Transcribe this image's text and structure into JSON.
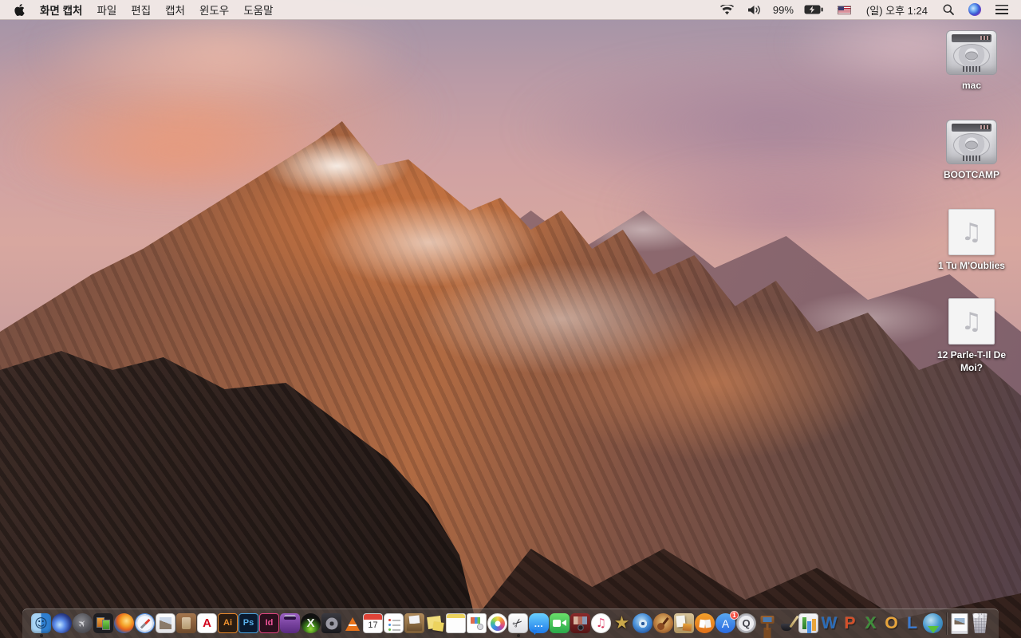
{
  "menu_bar": {
    "app_name": "화면 캡처",
    "menus": [
      "파일",
      "편집",
      "캡처",
      "윈도우",
      "도움말"
    ],
    "battery_percent": "99%",
    "clock": "(일) 오후 1:24",
    "status_icons": [
      "wifi-icon",
      "volume-icon",
      "battery-charging-icon",
      "us-flag-input-source-icon",
      "spotlight-search-icon",
      "siri-icon",
      "notification-center-icon"
    ]
  },
  "desktop": {
    "icons": [
      {
        "id": "mac",
        "label": "mac",
        "type": "drive"
      },
      {
        "id": "bootcamp",
        "label": "BOOTCAMP",
        "type": "drive"
      },
      {
        "id": "audio1",
        "label": "1 Tu M'Oublies",
        "type": "audio",
        "glyph": "♫"
      },
      {
        "id": "audio2",
        "label": "12 Parle-T-Il De Moi?",
        "type": "audio",
        "glyph": "♫"
      }
    ]
  },
  "dock": {
    "items": [
      {
        "id": "finder",
        "name": "Finder",
        "glyph": "☺",
        "running": true
      },
      {
        "id": "siri",
        "name": "Siri"
      },
      {
        "id": "launchpad",
        "name": "Launchpad",
        "glyph": "✈"
      },
      {
        "id": "displays",
        "name": "Display Sync App"
      },
      {
        "id": "firefox",
        "name": "Firefox"
      },
      {
        "id": "safari",
        "name": "Safari"
      },
      {
        "id": "preview",
        "name": "Preview"
      },
      {
        "id": "contacts",
        "name": "Contacts"
      },
      {
        "id": "acrobat",
        "name": "Adobe Acrobat Reader",
        "glyph": "A"
      },
      {
        "id": "illustrator",
        "name": "Adobe Illustrator",
        "glyph": "Ai"
      },
      {
        "id": "photoshop",
        "name": "Adobe Photoshop",
        "glyph": "Ps"
      },
      {
        "id": "indesign",
        "name": "Adobe InDesign",
        "glyph": "Id"
      },
      {
        "id": "toast",
        "name": "Toast Titanium"
      },
      {
        "id": "xapp",
        "name": "X Media App",
        "glyph": "X"
      },
      {
        "id": "discapp",
        "name": "Disc Utility App"
      },
      {
        "id": "vlc",
        "name": "VLC"
      },
      {
        "id": "calendar",
        "name": "Calendar",
        "glyph": "17"
      },
      {
        "id": "reminders",
        "name": "Reminders"
      },
      {
        "id": "unarchiver",
        "name": "Unarchiver"
      },
      {
        "id": "stickies",
        "name": "Stickies"
      },
      {
        "id": "notes",
        "name": "Notes"
      },
      {
        "id": "installdoc",
        "name": "Installer Document"
      },
      {
        "id": "photos",
        "name": "Photos"
      },
      {
        "id": "grab",
        "name": "화면 캡처",
        "glyph": "✂",
        "running": true
      },
      {
        "id": "messages",
        "name": "Messages",
        "glyph": "…"
      },
      {
        "id": "facetime",
        "name": "FaceTime"
      },
      {
        "id": "photobooth",
        "name": "Photo Booth"
      },
      {
        "id": "itunes",
        "name": "iTunes",
        "glyph": "♫"
      },
      {
        "id": "idvd",
        "name": "iDVD",
        "glyph": "★"
      },
      {
        "id": "dvdplayer",
        "name": "DVD Player"
      },
      {
        "id": "garageband",
        "name": "GarageBand"
      },
      {
        "id": "collage",
        "name": "Documents Collage App"
      },
      {
        "id": "ibooks",
        "name": "iBooks"
      },
      {
        "id": "appstore",
        "name": "App Store",
        "glyph": "A",
        "badge": "1"
      },
      {
        "id": "quicktime",
        "name": "QuickTime Player",
        "glyph": "Q"
      },
      {
        "id": "keynote",
        "name": "Keynote"
      },
      {
        "id": "pages09",
        "name": "Pages"
      },
      {
        "id": "numbers09",
        "name": "Numbers"
      },
      {
        "id": "word",
        "name": "Microsoft Word",
        "glyph": "W"
      },
      {
        "id": "powerpoint",
        "name": "Microsoft PowerPoint",
        "glyph": "P"
      },
      {
        "id": "excel",
        "name": "Microsoft Excel",
        "glyph": "X"
      },
      {
        "id": "outlook",
        "name": "Microsoft Outlook",
        "glyph": "O"
      },
      {
        "id": "lync",
        "name": "Microsoft Lync",
        "glyph": "L"
      },
      {
        "id": "msupdate",
        "name": "Download Globe App"
      },
      {
        "id": "separator"
      },
      {
        "id": "docfile",
        "name": "Document Shortcut"
      },
      {
        "id": "trash",
        "name": "Trash"
      }
    ]
  },
  "colors": {
    "menu_bar_bg": "#f1e9e6",
    "dock_bg": "rgba(93,83,77,0.58)",
    "badge_red": "#e02a1e",
    "label_text": "#ffffff"
  }
}
